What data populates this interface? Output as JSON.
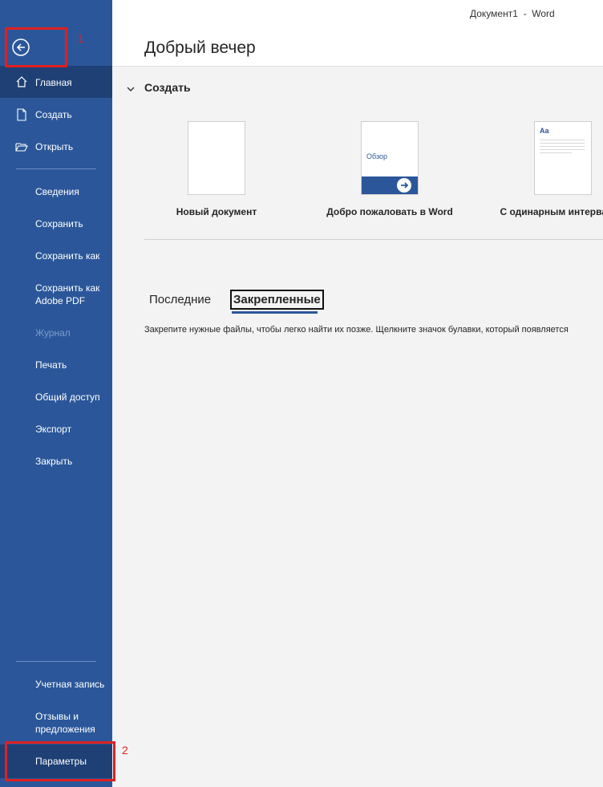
{
  "window": {
    "title": "Документ1  -  Word"
  },
  "sidebar": {
    "items": [
      {
        "label": "Главная"
      },
      {
        "label": "Создать"
      },
      {
        "label": "Открыть"
      },
      {
        "label": "Сведения"
      },
      {
        "label": "Сохранить"
      },
      {
        "label": "Сохранить как"
      },
      {
        "label": "Сохранить как\nAdobe PDF"
      },
      {
        "label": "Журнал"
      },
      {
        "label": "Печать"
      },
      {
        "label": "Общий доступ"
      },
      {
        "label": "Экспорт"
      },
      {
        "label": "Закрыть"
      }
    ],
    "footer": [
      {
        "label": "Учетная запись"
      },
      {
        "label": "Отзывы и\nпредложения"
      },
      {
        "label": "Параметры"
      }
    ]
  },
  "annotations": {
    "first": "1",
    "second": "2"
  },
  "main": {
    "greeting": "Добрый вечер",
    "section_title": "Создать",
    "templates": [
      {
        "label": "Новый документ"
      },
      {
        "label": "Добро пожаловать в Word",
        "thumb_text": "Обзор"
      },
      {
        "label": "С одинарным интервалом",
        "thumb_text": "Aa"
      }
    ],
    "tabs": {
      "recent": "Последние",
      "pinned": "Закрепленные"
    },
    "pinned_info": "Закрепите нужные файлы, чтобы легко найти их позже. Щелкните значок булавки, который появляется"
  },
  "colors": {
    "sidebar": "#2b579a",
    "sidebar_active": "#1e4075",
    "annotation": "#e02020"
  }
}
